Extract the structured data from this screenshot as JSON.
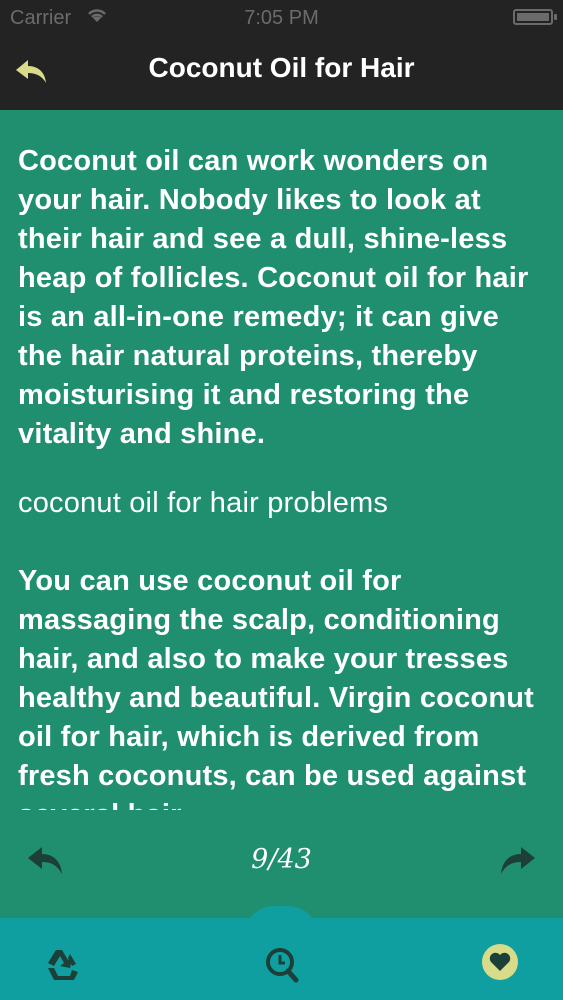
{
  "status_bar": {
    "carrier": "Carrier",
    "time": "7:05 PM",
    "wifi_icon": "wifi-icon",
    "battery_icon": "battery-icon"
  },
  "nav": {
    "title": "Coconut Oil for Hair",
    "back_icon": "back-arrow-icon"
  },
  "content": {
    "paragraph_1": "Coconut oil can work wonders on your hair. Nobody likes to look at their hair and see a dull, shine-less heap of follicles. Coconut oil for hair is an all-in-one remedy; it can give the hair natural proteins, thereby moisturising it and restoring the vitality and shine.",
    "subheading": "coconut oil for hair problems",
    "paragraph_2": "You can use coconut oil for massaging the scalp, conditioning hair, and also to make your tresses healthy and beautiful. Virgin coconut oil for hair, which is derived from fresh coconuts, can be used against several hair"
  },
  "pager": {
    "page_count": "9/43",
    "prev_icon": "previous-arrow-icon",
    "next_icon": "next-arrow-icon"
  },
  "tab_bar": {
    "icons": [
      "recycle-icon",
      "search-icon",
      "heart-icon"
    ]
  },
  "colors": {
    "background": "#1f8f6f",
    "nav_bar": "#232323",
    "tab_bar": "#0f9fa0",
    "accent_yellow": "#d8dc8a"
  }
}
